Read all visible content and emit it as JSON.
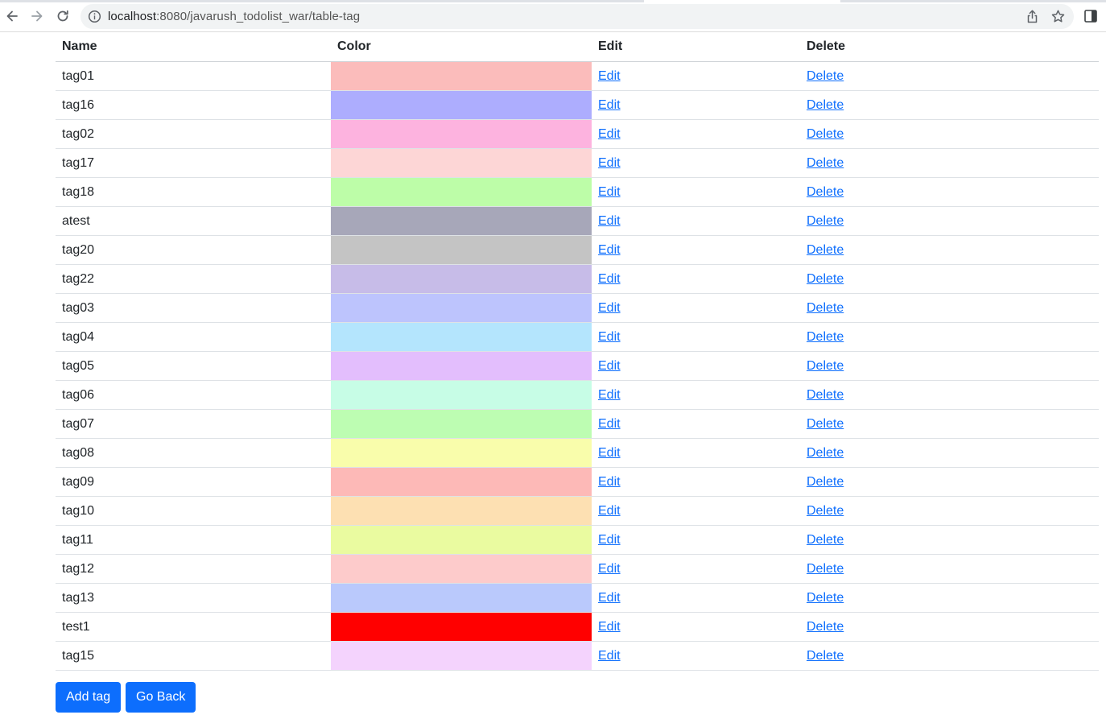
{
  "browser": {
    "url_host": "localhost",
    "url_rest": ":8080/javarush_todolist_war/table-tag",
    "icons": {
      "back": "arrow-left-icon",
      "forward": "arrow-right-icon",
      "reload": "reload-icon",
      "site_info": "info-icon",
      "share": "share-icon",
      "bookmark": "star-icon",
      "side_panel": "side-panel-icon"
    }
  },
  "table": {
    "headers": {
      "name": "Name",
      "color": "Color",
      "edit": "Edit",
      "delete": "Delete"
    },
    "rows": [
      {
        "name": "tag01",
        "color": "#fbbcbb",
        "edit": "Edit",
        "delete": "Delete"
      },
      {
        "name": "tag16",
        "color": "#adadfe",
        "edit": "Edit",
        "delete": "Delete"
      },
      {
        "name": "tag02",
        "color": "#fdb3df",
        "edit": "Edit",
        "delete": "Delete"
      },
      {
        "name": "tag17",
        "color": "#fdd6d6",
        "edit": "Edit",
        "delete": "Delete"
      },
      {
        "name": "tag18",
        "color": "#bdfda8",
        "edit": "Edit",
        "delete": "Delete"
      },
      {
        "name": "atest",
        "color": "#a7a7b9",
        "edit": "Edit",
        "delete": "Delete"
      },
      {
        "name": "tag20",
        "color": "#c4c4c4",
        "edit": "Edit",
        "delete": "Delete"
      },
      {
        "name": "tag22",
        "color": "#c7bce8",
        "edit": "Edit",
        "delete": "Delete"
      },
      {
        "name": "tag03",
        "color": "#bdc4fd",
        "edit": "Edit",
        "delete": "Delete"
      },
      {
        "name": "tag04",
        "color": "#b4e5fd",
        "edit": "Edit",
        "delete": "Delete"
      },
      {
        "name": "tag05",
        "color": "#e3befd",
        "edit": "Edit",
        "delete": "Delete"
      },
      {
        "name": "tag06",
        "color": "#c7fde6",
        "edit": "Edit",
        "delete": "Delete"
      },
      {
        "name": "tag07",
        "color": "#bdfdb2",
        "edit": "Edit",
        "delete": "Delete"
      },
      {
        "name": "tag08",
        "color": "#f9fdab",
        "edit": "Edit",
        "delete": "Delete"
      },
      {
        "name": "tag09",
        "color": "#fdb9b7",
        "edit": "Edit",
        "delete": "Delete"
      },
      {
        "name": "tag10",
        "color": "#fde0b2",
        "edit": "Edit",
        "delete": "Delete"
      },
      {
        "name": "tag11",
        "color": "#eafba0",
        "edit": "Edit",
        "delete": "Delete"
      },
      {
        "name": "tag12",
        "color": "#fdcbcb",
        "edit": "Edit",
        "delete": "Delete"
      },
      {
        "name": "tag13",
        "color": "#bac9fc",
        "edit": "Edit",
        "delete": "Delete"
      },
      {
        "name": "test1",
        "color": "#ff0000",
        "edit": "Edit",
        "delete": "Delete"
      },
      {
        "name": "tag15",
        "color": "#f4d3fd",
        "edit": "Edit",
        "delete": "Delete"
      }
    ]
  },
  "actions": {
    "add_tag": "Add tag",
    "go_back": "Go Back"
  },
  "colors": {
    "link": "#0d6efd",
    "primary_button": "#0d6efd",
    "row_border": "#dee2e6"
  }
}
